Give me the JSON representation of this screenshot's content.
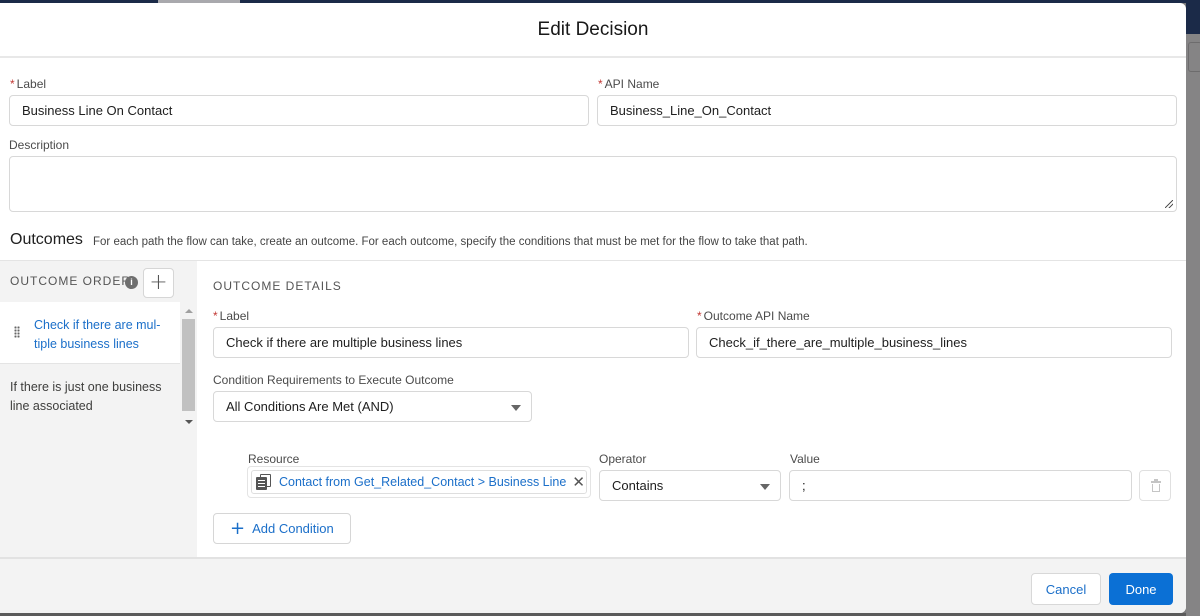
{
  "modal": {
    "title": "Edit Decision"
  },
  "fields": {
    "label": {
      "label": "Label",
      "required": "*",
      "value": "Business Line On Contact"
    },
    "api_name": {
      "label": "API Name",
      "required": "*",
      "value": "Business_Line_On_Contact"
    },
    "description": {
      "label": "Description",
      "value": ""
    }
  },
  "outcomes": {
    "heading": "Outcomes",
    "description": "For each path the flow can take, create an outcome. For each outcome, specify the conditions that must be met for the flow to take that path.",
    "order_heading": "OUTCOME ORDER",
    "info_icon": "i",
    "add_icon": "+",
    "items": [
      {
        "label": "Check if there are mul-tiple business lines",
        "active": true
      },
      {
        "label": "If there is just one business line associated",
        "active": false
      }
    ]
  },
  "details": {
    "heading": "OUTCOME DETAILS",
    "label": {
      "label": "Label",
      "required": "*",
      "value": "Check if there are multiple business lines"
    },
    "api_name": {
      "label": "Outcome API Name",
      "required": "*",
      "value": "Check_if_there_are_multiple_business_lines"
    },
    "condition_requirements": {
      "label": "Condition Requirements to Execute Outcome",
      "value": "All Conditions Are Met (AND)"
    },
    "condition": {
      "resource_label": "Resource",
      "resource_value": "Contact from Get_Related_Contact > Business Line",
      "remove_icon": "✕",
      "operator_label": "Operator",
      "operator_value": "Contains",
      "value_label": "Value",
      "value_value": ";"
    },
    "add_condition": {
      "icon": "+",
      "label": "Add Condition"
    }
  },
  "footer": {
    "cancel_label": "Cancel",
    "done_label": "Done"
  },
  "colors": {
    "brand": "#0b70d5",
    "link": "#1b6fc9",
    "required": "#c23934"
  }
}
